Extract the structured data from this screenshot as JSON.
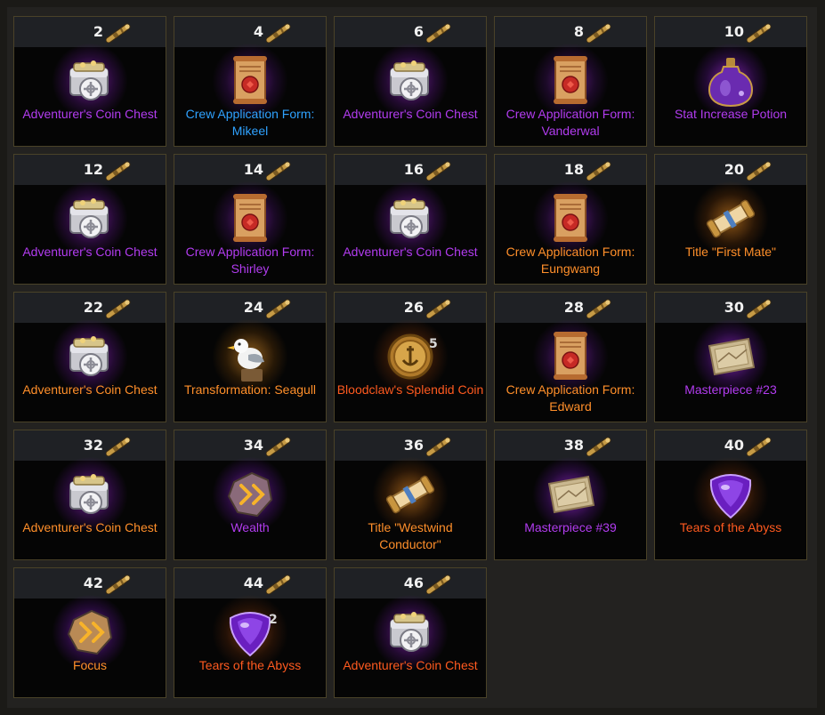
{
  "colors": {
    "purple": "#b23cf0",
    "blue": "#2fa2ff",
    "orange": "#ff8f2a",
    "red": "#ff5a1f"
  },
  "rewards": [
    {
      "count": "2",
      "icon": "coin-chest-icon",
      "label": "Adventurer's Coin Chest",
      "color": "purple",
      "qty": ""
    },
    {
      "count": "4",
      "icon": "crew-form-icon",
      "label": "Crew Application Form: Mikeel",
      "color": "blue",
      "qty": ""
    },
    {
      "count": "6",
      "icon": "coin-chest-icon",
      "label": "Adventurer's Coin Chest",
      "color": "purple",
      "qty": ""
    },
    {
      "count": "8",
      "icon": "crew-form-icon",
      "label": "Crew Application Form: Vanderwal",
      "color": "purple",
      "qty": ""
    },
    {
      "count": "10",
      "icon": "potion-icon",
      "label": "Stat Increase Potion",
      "color": "purple",
      "qty": ""
    },
    {
      "count": "12",
      "icon": "coin-chest-icon",
      "label": "Adventurer's Coin Chest",
      "color": "purple",
      "qty": ""
    },
    {
      "count": "14",
      "icon": "crew-form-icon",
      "label": "Crew Application Form: Shirley",
      "color": "purple",
      "qty": ""
    },
    {
      "count": "16",
      "icon": "coin-chest-icon",
      "label": "Adventurer's Coin Chest",
      "color": "purple",
      "qty": ""
    },
    {
      "count": "18",
      "icon": "crew-form-icon",
      "label": "Crew Application Form: Eungwang",
      "color": "orange",
      "qty": ""
    },
    {
      "count": "20",
      "icon": "scroll-icon",
      "label": "Title \"First Mate\"",
      "color": "orange",
      "qty": ""
    },
    {
      "count": "22",
      "icon": "coin-chest-icon",
      "label": "Adventurer's Coin Chest",
      "color": "orange",
      "qty": ""
    },
    {
      "count": "24",
      "icon": "seagull-icon",
      "label": "Transformation: Seagull",
      "color": "orange",
      "qty": ""
    },
    {
      "count": "26",
      "icon": "gold-coin-icon",
      "label": "Bloodclaw's Splendid Coin",
      "color": "red",
      "qty": "5"
    },
    {
      "count": "28",
      "icon": "crew-form-icon",
      "label": "Crew Application Form: Edward",
      "color": "orange",
      "qty": ""
    },
    {
      "count": "30",
      "icon": "masterpiece-icon",
      "label": "Masterpiece #23",
      "color": "purple",
      "qty": ""
    },
    {
      "count": "32",
      "icon": "coin-chest-icon",
      "label": "Adventurer's Coin Chest",
      "color": "orange",
      "qty": ""
    },
    {
      "count": "34",
      "icon": "rune-icon",
      "label": "Wealth",
      "color": "purple",
      "qty": ""
    },
    {
      "count": "36",
      "icon": "scroll-icon",
      "label": "Title \"Westwind Conductor\"",
      "color": "orange",
      "qty": ""
    },
    {
      "count": "38",
      "icon": "masterpiece-icon",
      "label": "Masterpiece #39",
      "color": "purple",
      "qty": ""
    },
    {
      "count": "40",
      "icon": "abyss-gem-icon",
      "label": "Tears of the Abyss",
      "color": "red",
      "qty": ""
    },
    {
      "count": "42",
      "icon": "rune-icon",
      "label": "Focus",
      "color": "orange",
      "qty": ""
    },
    {
      "count": "44",
      "icon": "abyss-gem-icon",
      "label": "Tears of the Abyss",
      "color": "red",
      "qty": "2"
    },
    {
      "count": "46",
      "icon": "coin-chest-icon",
      "label": "Adventurer's Coin Chest",
      "color": "red",
      "qty": ""
    }
  ]
}
